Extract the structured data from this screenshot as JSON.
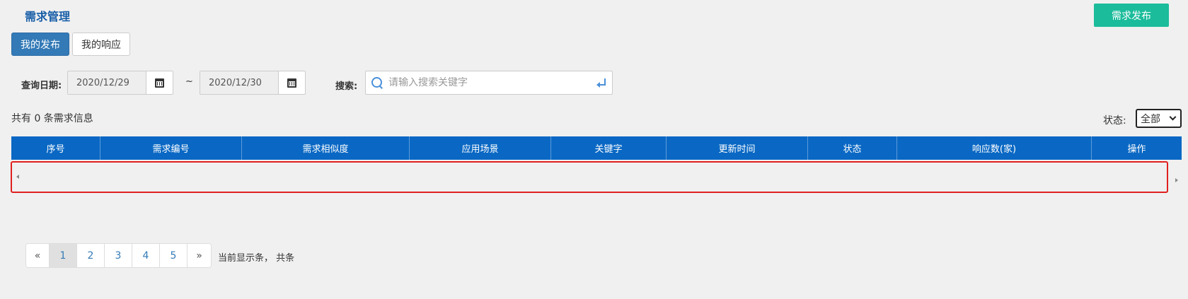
{
  "page": {
    "title": "需求管理"
  },
  "toolbar": {
    "publish_label": "需求发布"
  },
  "tabs": [
    {
      "label": "我的发布"
    },
    {
      "label": "我的响应"
    }
  ],
  "filters": {
    "date_label": "查询日期:",
    "date_from": "2020/12/29",
    "date_sep": "~",
    "date_to": "2020/12/30",
    "search_label": "搜索:",
    "search_placeholder": "请输入搜索关键字",
    "search_value": ""
  },
  "summary": {
    "count_text": "共有 0 条需求信息"
  },
  "status_filter": {
    "label": "状态:",
    "selected": "全部"
  },
  "table": {
    "columns": [
      "序号",
      "需求编号",
      "需求相似度",
      "应用场景",
      "关键字",
      "更新时间",
      "状态",
      "响应数(家)",
      "操作"
    ],
    "rows": []
  },
  "pagination": {
    "prev": "«",
    "pages": [
      "1",
      "2",
      "3",
      "4",
      "5"
    ],
    "active": "1",
    "next": "»",
    "info": "当前显示条，  共条"
  },
  "colors": {
    "accent": "#337ab7",
    "publish": "#1bbc9b",
    "table_header": "#0a68c4",
    "highlight_border": "#e02020"
  },
  "icons": [
    "calendar-icon",
    "search-icon",
    "enter-icon",
    "chevron-down-icon",
    "scroll-left-icon",
    "scroll-right-icon"
  ]
}
